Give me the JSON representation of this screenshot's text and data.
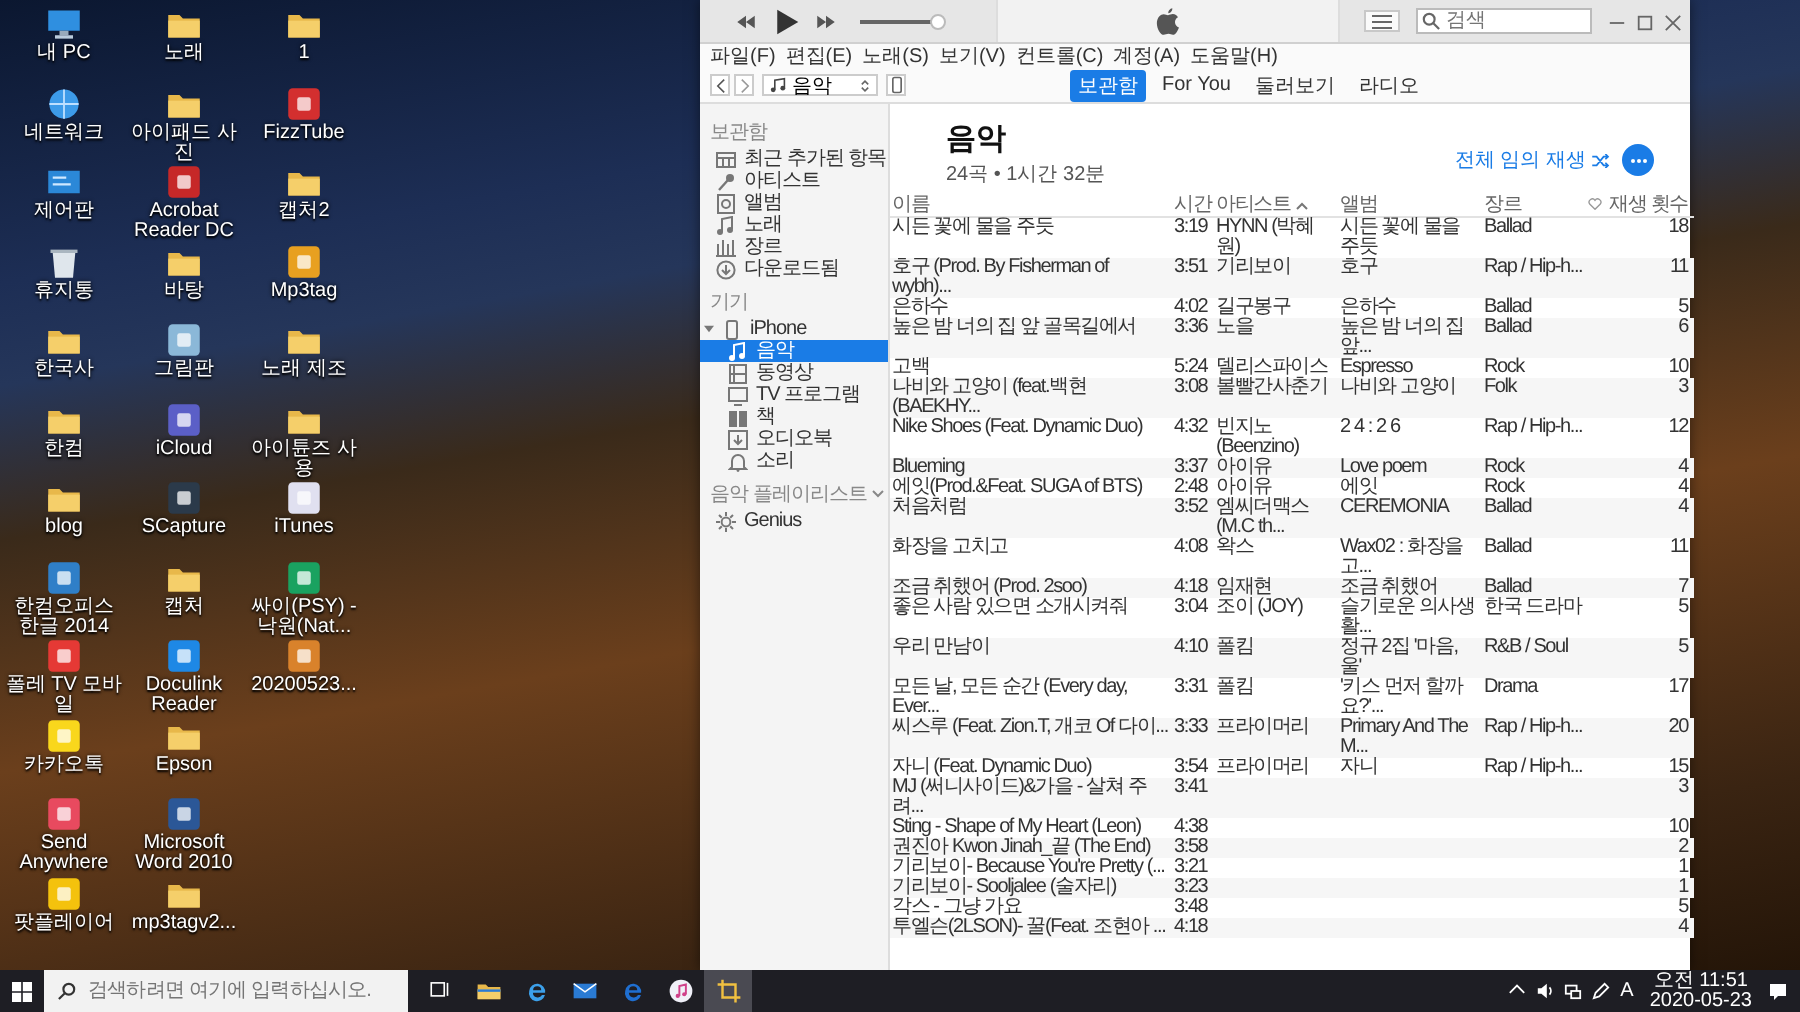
{
  "desktop": {
    "icons": [
      {
        "label": "내 PC",
        "kind": "pc"
      },
      {
        "label": "네트워크",
        "kind": "network"
      },
      {
        "label": "제어판",
        "kind": "control"
      },
      {
        "label": "휴지통",
        "kind": "trash"
      },
      {
        "label": "한국사",
        "kind": "folder"
      },
      {
        "label": "한컴",
        "kind": "folder"
      },
      {
        "label": "blog",
        "kind": "folder"
      },
      {
        "label": "한컴오피스 한글 2014",
        "kind": "app",
        "color": "#2f7fc8"
      },
      {
        "label": "폴레 TV 모바일",
        "kind": "app",
        "color": "#e53935"
      },
      {
        "label": "카카오톡",
        "kind": "app",
        "color": "#f9d71c"
      },
      {
        "label": "Send Anywhere",
        "kind": "app",
        "color": "#e84a5f"
      },
      {
        "label": "팟플레이어",
        "kind": "app",
        "color": "#f4c20d"
      },
      {
        "label": "노래",
        "kind": "folder"
      },
      {
        "label": "아이패드 사진",
        "kind": "folder"
      },
      {
        "label": "Acrobat Reader DC",
        "kind": "app",
        "color": "#c62828"
      },
      {
        "label": "바탕",
        "kind": "folder"
      },
      {
        "label": "그림판",
        "kind": "app",
        "color": "#8bb8d8"
      },
      {
        "label": "iCloud",
        "kind": "app",
        "color": "#5b5fc7"
      },
      {
        "label": "SCapture",
        "kind": "app",
        "color": "#2b3a4a"
      },
      {
        "label": "캡처",
        "kind": "folder"
      },
      {
        "label": "Doculink Reader",
        "kind": "app",
        "color": "#1e88e5"
      },
      {
        "label": "Epson",
        "kind": "folder"
      },
      {
        "label": "Microsoft Word 2010",
        "kind": "app",
        "color": "#2b5797"
      },
      {
        "label": "mp3tagv2...",
        "kind": "folder"
      },
      {
        "label": "1",
        "kind": "folder"
      },
      {
        "label": "FizzTube",
        "kind": "app",
        "color": "#d32f2f"
      },
      {
        "label": "캡처2",
        "kind": "folder"
      },
      {
        "label": "Mp3tag",
        "kind": "app",
        "color": "#e8a020"
      },
      {
        "label": "노래 제조",
        "kind": "folder"
      },
      {
        "label": "아이튠즈 사용",
        "kind": "folder"
      },
      {
        "label": "iTunes",
        "kind": "app",
        "color": "#e0e0f0"
      },
      {
        "label": "싸이(PSY) - 낙원(Nat...",
        "kind": "app",
        "color": "#1aa260"
      },
      {
        "label": "20200523...",
        "kind": "app",
        "color": "#d9822b"
      }
    ]
  },
  "itunes": {
    "player": {
      "volume": {
        "level": 0.92
      }
    },
    "search": {
      "placeholder": "검색"
    },
    "menu": [
      "파일(F)",
      "편집(E)",
      "노래(S)",
      "보기(V)",
      "컨트롤(C)",
      "계정(A)",
      "도움말(H)"
    ],
    "nav": {
      "source": "음악"
    },
    "tabs": [
      {
        "label": "보관함",
        "selected": true
      },
      {
        "label": "For You",
        "selected": false
      },
      {
        "label": "둘러보기",
        "selected": false
      },
      {
        "label": "라디오",
        "selected": false
      }
    ],
    "sidebar": {
      "library": {
        "heading": "보관함",
        "items": [
          {
            "label": "최근 추가된 항목",
            "kind": "grid",
            "selected": false
          },
          {
            "label": "아티스트",
            "kind": "mic",
            "selected": false
          },
          {
            "label": "앨범",
            "kind": "album",
            "selected": false
          },
          {
            "label": "노래",
            "kind": "note",
            "selected": false
          },
          {
            "label": "장르",
            "kind": "genre",
            "selected": false
          },
          {
            "label": "다운로드됨",
            "kind": "download",
            "selected": false
          }
        ]
      },
      "devices": {
        "heading": "기기",
        "items": [
          {
            "label": "iPhone",
            "kind": "phone",
            "expanded": true,
            "selected": false,
            "children": [
              {
                "label": "음악",
                "kind": "note",
                "selected": true
              },
              {
                "label": "동영상",
                "kind": "film",
                "selected": false
              },
              {
                "label": "TV 프로그램",
                "kind": "tv",
                "selected": false
              },
              {
                "label": "책",
                "kind": "book",
                "selected": false
              },
              {
                "label": "오디오북",
                "kind": "audiobook",
                "selected": false
              },
              {
                "label": "소리",
                "kind": "bell",
                "selected": false
              }
            ]
          }
        ]
      },
      "playlists": {
        "heading": "음악 플레이리스트",
        "items": [
          {
            "label": "Genius",
            "kind": "genius",
            "selected": false
          }
        ]
      }
    },
    "header": {
      "title": "음악",
      "subtitle": "24곡 • 1시간 32분",
      "shuffle": "전체 임의 재생"
    },
    "table": {
      "columns": [
        {
          "label": "이름",
          "kind": "text"
        },
        {
          "label": "시간",
          "kind": "text"
        },
        {
          "label": "아티스트",
          "kind": "text",
          "sorted": true
        },
        {
          "label": "앨범",
          "kind": "text"
        },
        {
          "label": "장르",
          "kind": "text"
        },
        {
          "kind": "heart"
        },
        {
          "label": "재생 횟수",
          "kind": "text"
        }
      ],
      "rows": [
        {
          "name": "시든 꽃에 물을 주듯",
          "time": "3:19",
          "artist": "HYNN (박혜원)",
          "album": "시든 꽃에 물을 주듯",
          "genre": "Ballad",
          "plays": "18"
        },
        {
          "name": "호구 (Prod. By Fisherman of wybh)...",
          "time": "3:51",
          "artist": "기리보이",
          "album": "호구",
          "genre": "Rap / Hip-h...",
          "plays": "11"
        },
        {
          "name": "은하수",
          "time": "4:02",
          "artist": "길구봉구",
          "album": "은하수",
          "genre": "Ballad",
          "plays": "5"
        },
        {
          "name": "높은 밤 너의 집 앞 골목길에서",
          "time": "3:36",
          "artist": "노을",
          "album": "높은 밤 너의 집 앞...",
          "genre": "Ballad",
          "plays": "6"
        },
        {
          "name": "고백",
          "time": "5:24",
          "artist": "델리스파이스",
          "album": "Espresso",
          "genre": "Rock",
          "plays": "10"
        },
        {
          "name": "나비와 고양이 (feat.백현 (BAEKHY...",
          "time": "3:08",
          "artist": "볼빨간사춘기",
          "album": "나비와 고양이",
          "genre": "Folk",
          "plays": "3"
        },
        {
          "name": "Nike Shoes (Feat. Dynamic Duo)",
          "time": "4:32",
          "artist": "빈지노 (Beenzino)",
          "album": "2 4 : 2 6",
          "genre": "Rap / Hip-h...",
          "plays": "12"
        },
        {
          "name": "Blueming",
          "time": "3:37",
          "artist": "아이유",
          "album": "Love poem",
          "genre": "Rock",
          "plays": "4"
        },
        {
          "name": "에잇(Prod.&Feat. SUGA of BTS)",
          "time": "2:48",
          "artist": "아이유",
          "album": "에잇",
          "genre": "Rock",
          "plays": "4"
        },
        {
          "name": "처음처럼",
          "time": "3:52",
          "artist": "엠씨더맥스 (M.C th...",
          "album": "CEREMONIA",
          "genre": "Ballad",
          "plays": "4"
        },
        {
          "name": "화장을 고치고",
          "time": "4:08",
          "artist": "왁스",
          "album": "Wax02 : 화장을 고...",
          "genre": "Ballad",
          "plays": "11"
        },
        {
          "name": "조금 취했어 (Prod. 2soo)",
          "time": "4:18",
          "artist": "임재현",
          "album": "조금 취했어",
          "genre": "Ballad",
          "plays": "7"
        },
        {
          "name": "좋은 사람 있으면 소개시켜줘",
          "time": "3:04",
          "artist": "조이 (JOY)",
          "album": "슬기로운 의사생활...",
          "genre": "한국 드라마",
          "plays": "5"
        },
        {
          "name": "우리 만남이",
          "time": "4:10",
          "artist": "폴킴",
          "album": "정규 2집 '마음, 울'",
          "genre": "R&B / Soul",
          "plays": "5"
        },
        {
          "name": "모든 날, 모든 순간 (Every day, Ever...",
          "time": "3:31",
          "artist": "폴킴",
          "album": "'키스 먼저 할까요?'...",
          "genre": "Drama",
          "plays": "17"
        },
        {
          "name": "씨스루 (Feat. Zion.T, 개코 Of 다이...",
          "time": "3:33",
          "artist": "프라이머리",
          "album": "Primary And The M...",
          "genre": "Rap / Hip-h...",
          "plays": "20"
        },
        {
          "name": "자니 (Feat. Dynamic Duo)",
          "time": "3:54",
          "artist": "프라이머리",
          "album": "자니",
          "genre": "Rap / Hip-h...",
          "plays": "15"
        },
        {
          "name": "MJ (써니사이드)&가을 - 살쳐 주려...",
          "time": "3:41",
          "plays": "3"
        },
        {
          "name": "Sting - Shape of My Heart (Leon)",
          "time": "4:38",
          "plays": "10"
        },
        {
          "name": "권진아 Kwon Jinah_끝 (The End)",
          "time": "3:58",
          "plays": "2"
        },
        {
          "name": "기리보이- Because You're Pretty (...",
          "time": "3:21",
          "plays": "1"
        },
        {
          "name": "기리보이- Sooljalee (술자리)",
          "time": "3:23",
          "plays": "1"
        },
        {
          "name": "각스 - 그냥 가요",
          "time": "3:48",
          "plays": "5"
        },
        {
          "name": "투엘슨(2LSON)- 꿀(Feat. 조현아 ...",
          "time": "4:18",
          "plays": "4"
        }
      ]
    }
  },
  "taskbar": {
    "search": {
      "placeholder": "검색하려면 여기에 입력하십시오."
    },
    "apps": [
      {
        "kind": "taskview",
        "active": false
      },
      {
        "kind": "explorer",
        "active": false
      },
      {
        "kind": "ie",
        "active": false
      },
      {
        "kind": "mail",
        "active": false
      },
      {
        "kind": "edge",
        "active": false
      },
      {
        "kind": "itunes",
        "active": false
      },
      {
        "kind": "capture",
        "active": true
      }
    ],
    "ime": "A",
    "time": "오전 11:51",
    "date": "2020-05-23"
  }
}
